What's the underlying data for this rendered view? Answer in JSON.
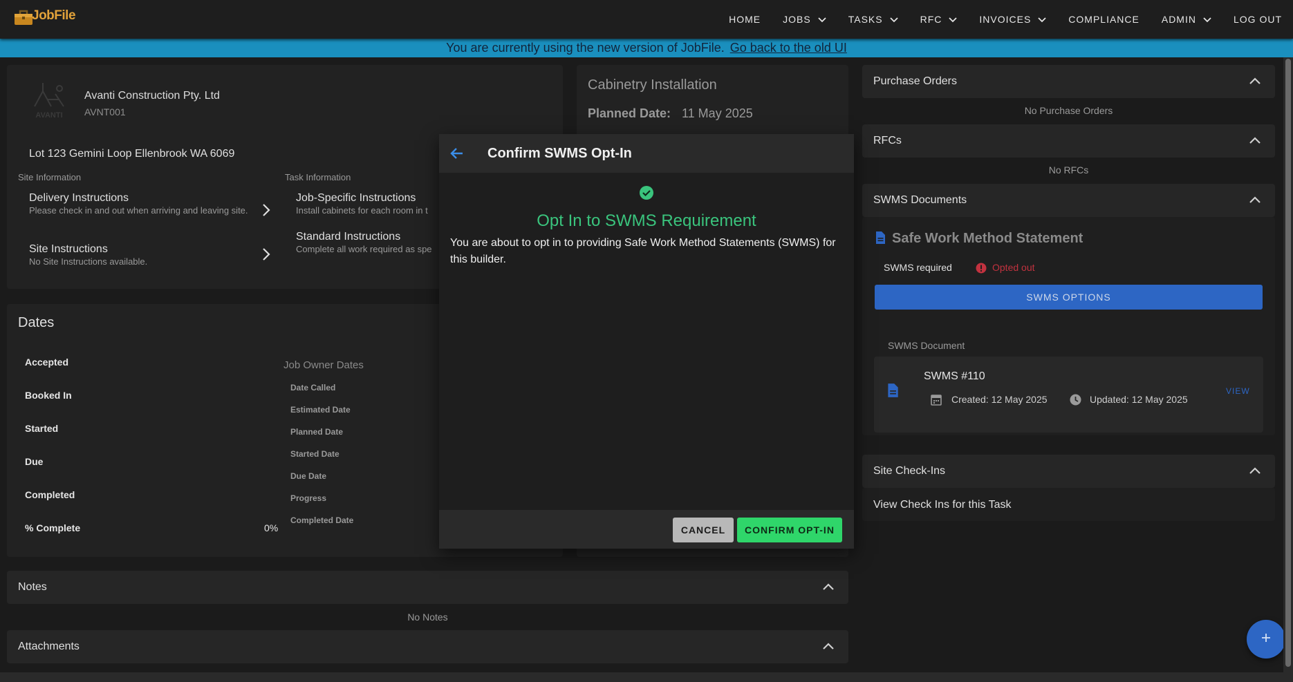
{
  "app": {
    "logo_text": "JobFile"
  },
  "nav": {
    "items": [
      {
        "label": "HOME",
        "dropdown": false
      },
      {
        "label": "JOBS",
        "dropdown": true
      },
      {
        "label": "TASKS",
        "dropdown": true
      },
      {
        "label": "RFC",
        "dropdown": true
      },
      {
        "label": "INVOICES",
        "dropdown": true
      },
      {
        "label": "COMPLIANCE",
        "dropdown": false
      },
      {
        "label": "ADMIN",
        "dropdown": true
      },
      {
        "label": "LOG OUT",
        "dropdown": false
      }
    ]
  },
  "banner": {
    "text": "You are currently using the new version of JobFile.",
    "link": "Go back to the old UI"
  },
  "company": {
    "logo_text": "AVANTI",
    "name": "Avanti Construction Pty. Ltd",
    "code": "AVNT001",
    "address": "Lot 123 Gemini Loop Ellenbrook WA 6069"
  },
  "site_info": {
    "header": "Site Information",
    "items": [
      {
        "title": "Delivery Instructions",
        "sub": "Please check in and out when arriving and leaving site."
      },
      {
        "title": "Site Instructions",
        "sub": "No Site Instructions available."
      }
    ]
  },
  "task_info": {
    "header": "Task Information",
    "items": [
      {
        "title": "Job-Specific Instructions",
        "sub": "Install cabinets for each room in t"
      },
      {
        "title": "Standard Instructions",
        "sub": "Complete all work required as spe"
      }
    ]
  },
  "task": {
    "title": "Cabinetry Installation",
    "planned_label": "Planned Date:",
    "planned_value": "11 May 2025"
  },
  "dates": {
    "title": "Dates",
    "labels": [
      "Accepted",
      "Booked In",
      "Started",
      "Due",
      "Completed",
      "% Complete"
    ],
    "percent_value": "0%",
    "job_owner_header": "Job Owner Dates",
    "job_owner_labels": [
      "Date Called",
      "Estimated Date",
      "Planned Date",
      "Started Date",
      "Due Date",
      "Progress",
      "Completed Date"
    ]
  },
  "notes": {
    "title": "Notes",
    "empty": "No Notes"
  },
  "attachments": {
    "title": "Attachments"
  },
  "purchase_orders": {
    "title": "Purchase Orders",
    "empty": "No Purchase Orders"
  },
  "rfcs": {
    "title": "RFCs",
    "empty": "No RFCs"
  },
  "swms": {
    "section_title": "SWMS Documents",
    "card_title": "Safe Work Method Statement",
    "required_label": "SWMS required",
    "status": "Opted out",
    "options_button": "SWMS OPTIONS",
    "doc_header": "SWMS Document",
    "doc_name": "SWMS #110",
    "created": "Created: 12 May 2025",
    "updated": "Updated: 12 May 2025",
    "view": "VIEW"
  },
  "checkins": {
    "title": "Site Check-Ins",
    "link": "View Check Ins for this Task"
  },
  "modal": {
    "title": "Confirm SWMS Opt-In",
    "headline": "Opt In to SWMS Requirement",
    "body": "You are about to opt in to providing Safe Work Method Statements (SWMS) for this builder.",
    "cancel": "CANCEL",
    "confirm": "CONFIRM OPT-IN"
  },
  "colors": {
    "accent": "#2d66c4",
    "success": "#2fd66a",
    "danger": "#c2323f",
    "banner": "#1a8fbe"
  }
}
